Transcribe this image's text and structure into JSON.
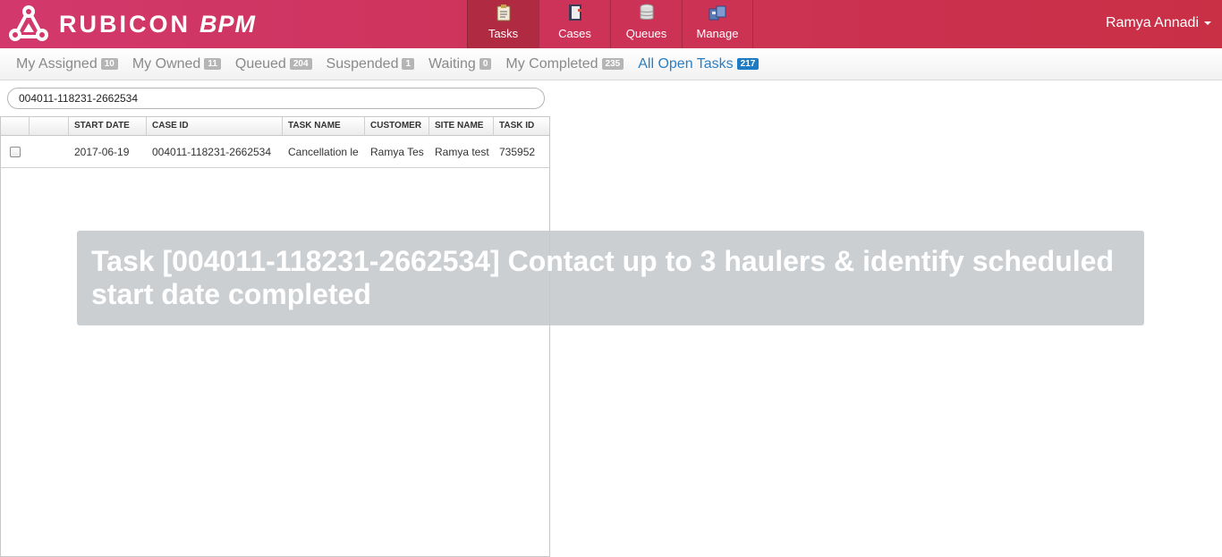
{
  "app": {
    "logo_text": "RUBICON",
    "logo_suffix": "BPM"
  },
  "nav": [
    {
      "label": "Tasks",
      "icon": "clipboard-icon",
      "active": true
    },
    {
      "label": "Cases",
      "icon": "binder-icon",
      "active": false
    },
    {
      "label": "Queues",
      "icon": "database-icon",
      "active": false
    },
    {
      "label": "Manage",
      "icon": "briefcase-icon",
      "active": false
    }
  ],
  "user": {
    "name": "Ramya Annadi"
  },
  "subtabs": [
    {
      "label": "My Assigned",
      "count": "10"
    },
    {
      "label": "My Owned",
      "count": "11"
    },
    {
      "label": "Queued",
      "count": "204"
    },
    {
      "label": "Suspended",
      "count": "1"
    },
    {
      "label": "Waiting",
      "count": "0"
    },
    {
      "label": "My Completed",
      "count": "235"
    },
    {
      "label": "All Open Tasks",
      "count": "217",
      "active": true
    }
  ],
  "search": {
    "value": "004011-118231-2662534"
  },
  "grid": {
    "columns": [
      "",
      "",
      "START DATE",
      "CASE ID",
      "TASK NAME",
      "CUSTOMER",
      "SITE NAME",
      "TASK ID"
    ],
    "rows": [
      {
        "start_date": "2017-06-19",
        "case_id": "004011-118231-2662534",
        "task_name": "Cancellation le",
        "customer": "Ramya Tes",
        "site_name": "Ramya test",
        "task_id": "735952"
      }
    ]
  },
  "toast": {
    "message": "Task [004011-118231-2662534] Contact up to 3 haulers & identify scheduled start date completed"
  },
  "colors": {
    "header": "#cd3358",
    "active_nav": "#b02a42",
    "active_tab": "#2a7fc4",
    "badge": "#b5b5b5",
    "active_badge": "#1f7cc4"
  }
}
